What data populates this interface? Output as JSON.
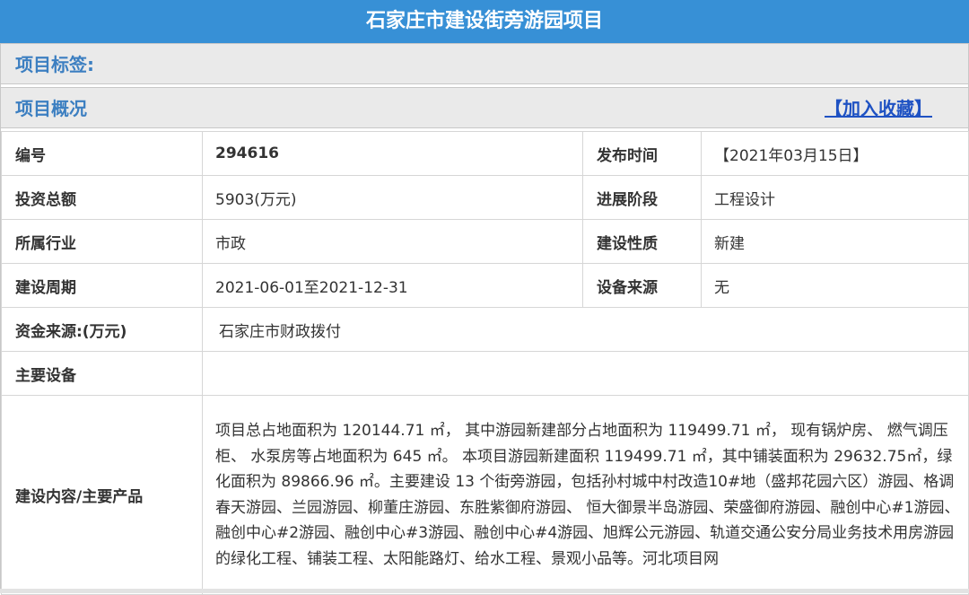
{
  "title": "石家庄市建设街旁游园项目",
  "sections": {
    "tags_label": "项目标签:",
    "overview_label": "项目概况",
    "favorite_link": "【加入收藏】"
  },
  "fields": {
    "id_label": "编号",
    "id_value": "294616",
    "publish_label": "发布时间",
    "publish_value": "【2021年03月15日】",
    "investment_label": "投资总额",
    "investment_value": "5903(万元)",
    "stage_label": "进展阶段",
    "stage_value": "工程设计",
    "industry_label": "所属行业",
    "industry_value": "市政",
    "nature_label": "建设性质",
    "nature_value": "新建",
    "period_label": "建设周期",
    "period_value": "2021-06-01至2021-12-31",
    "equipment_source_label": "设备来源",
    "equipment_source_value": "无",
    "fund_label": "资金来源:(万元)",
    "fund_value": "石家庄市财政拨付",
    "main_equipment_label": "主要设备",
    "main_equipment_value": "",
    "content_label": "建设内容/主要产品",
    "content_value": "项目总占地面积为 120144.71 ㎡， 其中游园新建部分占地面积为 119499.71 ㎡， 现有锅炉房、 燃气调压柜、 水泵房等占地面积为 645 ㎡。 本项目游园新建面积 119499.71 ㎡，其中铺装面积为 29632.75㎡，绿化面积为 89866.96 ㎡。主要建设 13 个街旁游园，包括孙村城中村改造10#地（盛邦花园六区）游园、格调春天游园、兰园游园、柳董庄游园、东胜紫御府游园、 恒大御景半岛游园、荣盛御府游园、融创中心#1游园、融创中心#2游园、融创中心#3游园、融创中心#4游园、旭辉公元游园、轨道交通公安分局业务技术用房游园的绿化工程、铺装工程、太阳能路灯、给水工程、景观小品等。河北项目网"
  },
  "colors": {
    "title_bg": "#3790d6",
    "section_bg": "#eaeaea",
    "section_text": "#3c7fc1",
    "link": "#1f52c3",
    "id_value": "#a3202a"
  }
}
